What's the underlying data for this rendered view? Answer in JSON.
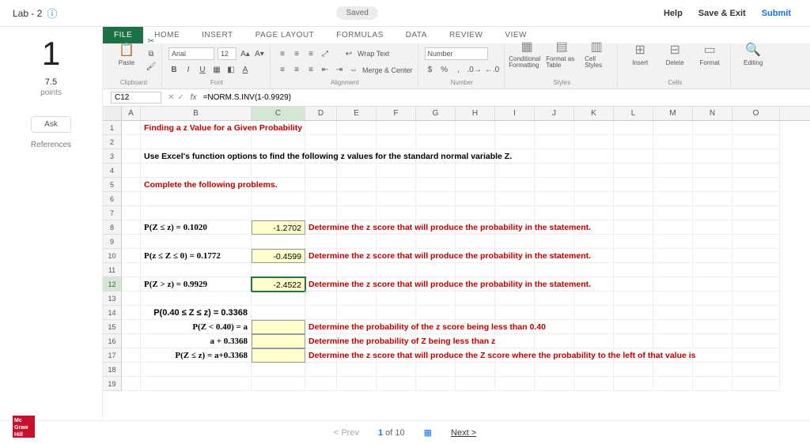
{
  "top": {
    "title": "Lab - 2",
    "saved": "Saved",
    "help": "Help",
    "save_exit": "Save & Exit",
    "submit": "Submit"
  },
  "sidebar": {
    "qnum": "1",
    "points": "7.5",
    "points_lbl": "points",
    "ask": "Ask",
    "references": "References"
  },
  "ribbon": {
    "tabs": [
      "FILE",
      "HOME",
      "INSERT",
      "PAGE LAYOUT",
      "FORMULAS",
      "DATA",
      "REVIEW",
      "VIEW"
    ],
    "paste": "Paste",
    "font_name": "Arial",
    "font_size": "12",
    "wrap": "Wrap Text",
    "merge": "Merge & Center",
    "num_fmt": "Number",
    "cond": "Conditional Formatting",
    "fmt_tbl": "Format as Table",
    "cell_styles": "Cell Styles",
    "insert": "Insert",
    "delete": "Delete",
    "format": "Format",
    "editing": "Editing",
    "grp_clipboard": "Clipboard",
    "grp_font": "Font",
    "grp_align": "Alignment",
    "grp_number": "Number",
    "grp_styles": "Styles",
    "grp_cells": "Cells"
  },
  "formula": {
    "cell_ref": "C12",
    "value": "=NORM.S.INV(1-0.9929)"
  },
  "columns": [
    "A",
    "B",
    "C",
    "D",
    "E",
    "F",
    "G",
    "H",
    "I",
    "J",
    "K",
    "L",
    "M",
    "N",
    "O"
  ],
  "rows": {
    "1": {
      "b": "Finding a z Value for a Given Probability"
    },
    "3": {
      "b": "Use Excel's function options to find the following z values for the standard normal variable Z."
    },
    "5": {
      "b": "Complete the following problems."
    },
    "8": {
      "b": "P(Z ≤ z) = 0.1020",
      "c": "-1.2702",
      "d": "Determine the z score that will produce the probability in the statement."
    },
    "10": {
      "b": "P(z ≤ Z ≤ 0) = 0.1772",
      "c": "-0.4599",
      "d": "Determine the z score that will produce the probability in the statement."
    },
    "12": {
      "b": "P(Z > z) = 0.9929",
      "c": "-2.4522",
      "d": "Determine the z score that will produce the probability in the statement."
    },
    "14": {
      "b": "P(0.40 ≤ Z ≤ z) = 0.3368"
    },
    "15": {
      "b": "P(Z < 0.40) = a",
      "d": "Determine the probability of the z score being less than 0.40"
    },
    "16": {
      "b": "a + 0.3368",
      "d": "Determine the probability of Z being less than z"
    },
    "17": {
      "b": "P(Z ≤ z) = a+0.3368",
      "d": "Determine the z score that will produce the Z score where the probability to the left of that value is"
    }
  },
  "nav": {
    "prev": "Prev",
    "pos_cur": "1",
    "pos_of": "of",
    "pos_tot": "10",
    "next": "Next"
  },
  "logo": "Mc Graw Hill"
}
